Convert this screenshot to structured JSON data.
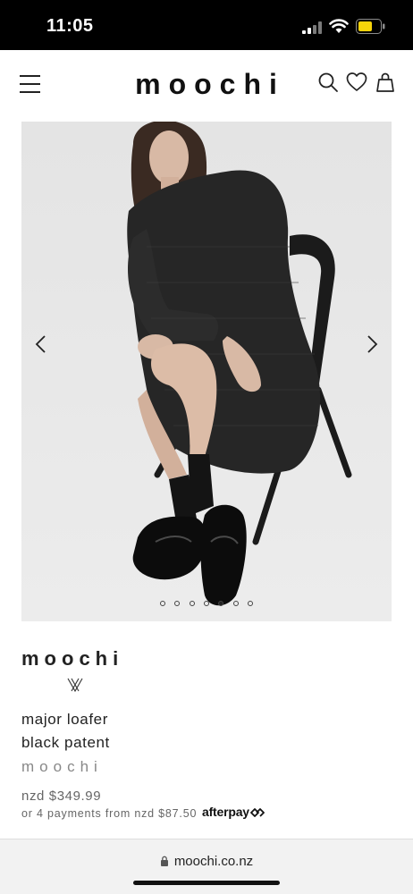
{
  "status_bar": {
    "time": "11:05",
    "icons": [
      "signal-icon",
      "wifi-icon",
      "battery-icon"
    ],
    "battery_color": "#f6d30a"
  },
  "header": {
    "logo": "moochi",
    "icons": [
      "menu-icon",
      "search-icon",
      "heart-icon",
      "bag-icon"
    ]
  },
  "gallery": {
    "image_count": 7,
    "active_index": 5,
    "icons": [
      "chevron-left-icon",
      "chevron-right-icon"
    ]
  },
  "product": {
    "brand_logo": "moochi",
    "title_line1": "major loafer",
    "title_line2": "black patent",
    "brand": "moochi",
    "price": "nzd $349.99",
    "installments": "or 4 payments from nzd $87.50",
    "afterpay_label": "afterpay"
  },
  "browser": {
    "url": "moochi.co.nz"
  }
}
